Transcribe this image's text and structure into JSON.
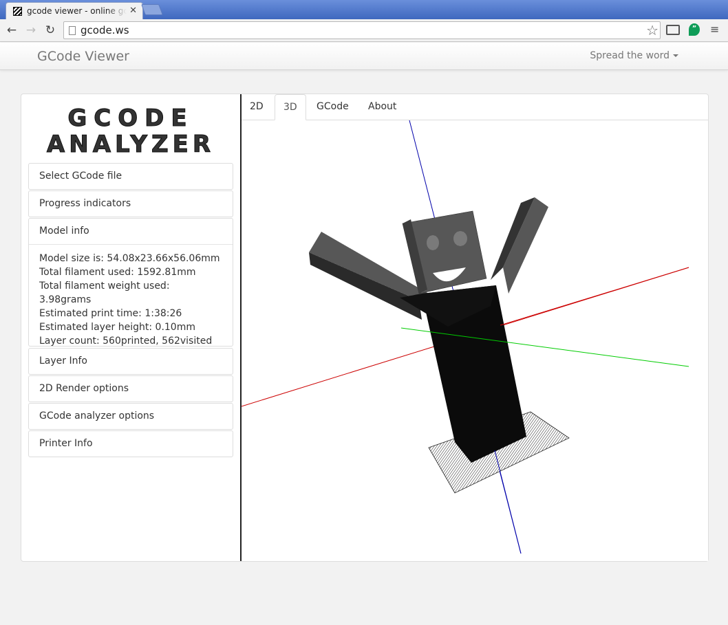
{
  "browser": {
    "tab_title": "gcode viewer - online gcode",
    "url": "gcode.ws"
  },
  "navbar": {
    "brand": "GCode Viewer",
    "spread": "Spread the word"
  },
  "logo": {
    "line1": "GCODE",
    "line2": "ANALYZER"
  },
  "sidebar": {
    "select_file": "Select GCode file",
    "progress": "Progress indicators",
    "model_info": "Model info",
    "model_lines": [
      "Model size is: 54.08x23.66x56.06mm",
      "Total filament used: 1592.81mm",
      "Total filament weight used: 3.98grams",
      "Estimated print time: 1:38:26",
      "Estimated layer height: 0.10mm",
      "Layer count: 560printed, 562visited"
    ],
    "layer_info": "Layer Info",
    "render_options": "2D Render options",
    "analyzer_options": "GCode analyzer options",
    "printer_info": "Printer Info"
  },
  "tabs": [
    "2D",
    "3D",
    "GCode",
    "About"
  ],
  "active_tab": "3D",
  "colors": {
    "x_axis": "#cc0000",
    "y_axis": "#00cc00",
    "z_axis": "#0000aa",
    "model_dark": "#111111",
    "model_grey": "#5a5a5a"
  }
}
